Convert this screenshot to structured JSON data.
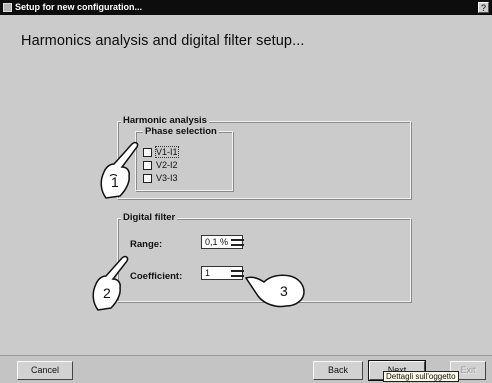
{
  "window": {
    "title": "Setup for new configuration...",
    "help_label": "?"
  },
  "page": {
    "heading": "Harmonics analysis and digital filter setup..."
  },
  "harmonic_analysis": {
    "label": "Harmonic analysis",
    "phase_selection": {
      "label": "Phase selection",
      "options": [
        {
          "label": "V1-I1",
          "checked": false
        },
        {
          "label": "V2-I2",
          "checked": false
        },
        {
          "label": "V3-I3",
          "checked": false
        }
      ]
    }
  },
  "digital_filter": {
    "label": "Digital filter",
    "range": {
      "label": "Range:",
      "value": "0,1 %"
    },
    "coefficient": {
      "label": "Coefficient:",
      "value": "1"
    }
  },
  "callouts": [
    "1",
    "2",
    "3"
  ],
  "buttons": {
    "cancel": "Cancel",
    "back": "Back",
    "next": "Next",
    "exit": "Exit"
  },
  "tooltip": "Dettagli sull'oggetto"
}
